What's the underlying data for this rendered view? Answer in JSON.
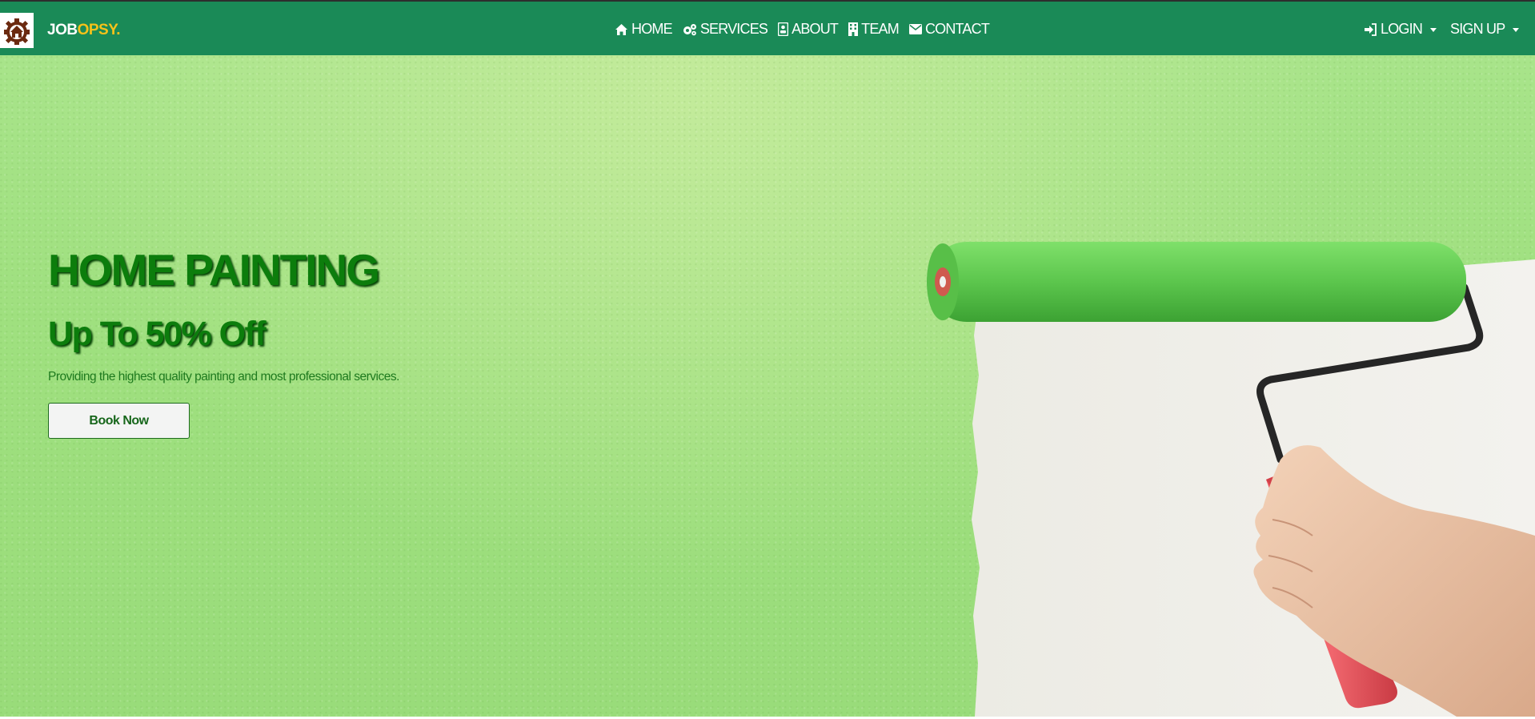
{
  "brand": {
    "name_part_a": "JOB",
    "name_part_b": "OPSY.",
    "logo_icon": "house-gear-logo-icon",
    "accent_color": "#f6c21a"
  },
  "nav": {
    "background_color": "#1a8a57",
    "links": [
      {
        "label": "HOME",
        "icon": "home-icon"
      },
      {
        "label": "SERVICES",
        "icon": "cogs-icon"
      },
      {
        "label": "ABOUT",
        "icon": "address-card-icon"
      },
      {
        "label": "TEAM",
        "icon": "building-icon"
      },
      {
        "label": "CONTACT",
        "icon": "envelope-icon"
      }
    ],
    "right": [
      {
        "label": "LOGIN",
        "icon": "sign-in-icon",
        "dropdown": true
      },
      {
        "label": "SIGN UP",
        "dropdown": true
      }
    ]
  },
  "hero": {
    "title": "HOME PAINTING",
    "subtitle": "Up To 50% Off",
    "description": "Providing the highest quality painting and most professional services.",
    "cta_label": "Book Now",
    "text_color": "#0c7d0c",
    "image": "paint-roller-on-green-wall"
  }
}
